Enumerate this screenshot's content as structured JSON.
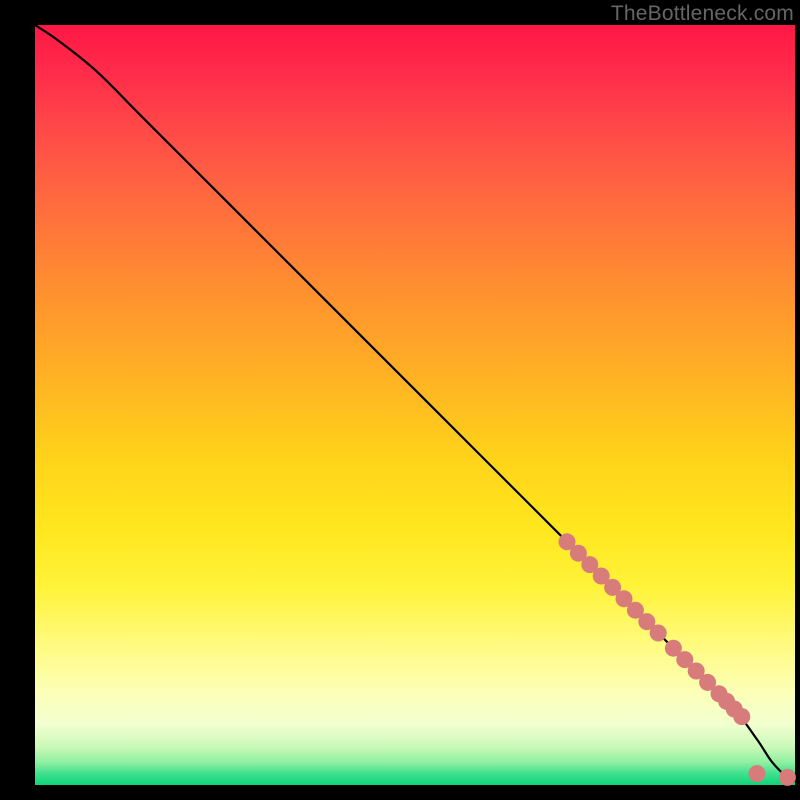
{
  "watermark": "TheBottleneck.com",
  "colors": {
    "dot": "#d87b7b",
    "curve": "#000000",
    "background": "#000000"
  },
  "chart_data": {
    "type": "line",
    "title": "",
    "xlabel": "",
    "ylabel": "",
    "xlim": [
      0,
      100
    ],
    "ylim": [
      0,
      100
    ],
    "x": [
      0,
      3,
      8,
      14,
      22,
      32,
      45,
      58,
      70,
      82,
      88,
      92,
      95,
      97,
      99,
      100
    ],
    "y": [
      100,
      98,
      94,
      88,
      80,
      70,
      57,
      44,
      32,
      20,
      14,
      10,
      6,
      3,
      1,
      0.5
    ],
    "points": {
      "comment": "clustered markers along the lower-right section of the curve and near the bottom edge",
      "x": [
        70,
        71.5,
        73,
        74.5,
        76,
        77.5,
        79,
        80.5,
        82,
        84,
        85.5,
        87,
        88.5,
        90,
        91,
        92,
        93,
        95,
        99
      ],
      "y": [
        32,
        30.5,
        29,
        27.5,
        26,
        24.5,
        23,
        21.5,
        20,
        18,
        16.5,
        15,
        13.5,
        12,
        11,
        10,
        9,
        1.5,
        1
      ]
    }
  }
}
